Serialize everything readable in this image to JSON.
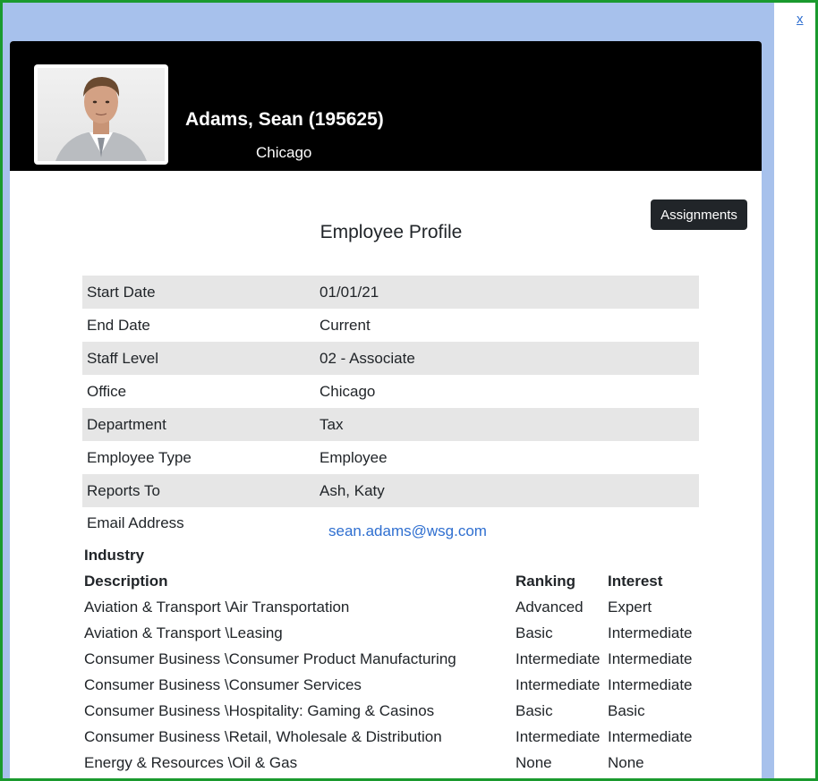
{
  "close_label": "x",
  "header": {
    "name": "Adams, Sean (195625)",
    "city": "Chicago"
  },
  "assignments_label": "Assignments",
  "profile_title": "Employee Profile",
  "details": [
    {
      "label": "Start Date",
      "value": "01/01/21"
    },
    {
      "label": "End Date",
      "value": "Current"
    },
    {
      "label": "Staff Level",
      "value": "02 - Associate"
    },
    {
      "label": "Office",
      "value": "Chicago"
    },
    {
      "label": "Department",
      "value": "Tax"
    },
    {
      "label": "Employee Type",
      "value": "Employee"
    },
    {
      "label": "Reports To",
      "value": "Ash, Katy"
    }
  ],
  "email": {
    "label": "Email Address",
    "value": "sean.adams@wsg.com"
  },
  "industry": {
    "title": "Industry",
    "columns": {
      "description": "Description",
      "ranking": "Ranking",
      "interest": "Interest"
    },
    "rows": [
      {
        "description": "Aviation & Transport \\Air Transportation",
        "ranking": "Advanced",
        "interest": "Expert"
      },
      {
        "description": "Aviation & Transport \\Leasing",
        "ranking": "Basic",
        "interest": "Intermediate"
      },
      {
        "description": "Consumer Business \\Consumer Product Manufacturing",
        "ranking": "Intermediate",
        "interest": "Intermediate"
      },
      {
        "description": "Consumer Business \\Consumer Services",
        "ranking": "Intermediate",
        "interest": "Intermediate"
      },
      {
        "description": "Consumer Business \\Hospitality: Gaming & Casinos",
        "ranking": "Basic",
        "interest": "Basic"
      },
      {
        "description": "Consumer Business \\Retail, Wholesale & Distribution",
        "ranking": "Intermediate",
        "interest": "Intermediate"
      },
      {
        "description": "Energy & Resources \\Oil & Gas",
        "ranking": "None",
        "interest": "None"
      }
    ]
  },
  "colors": {
    "frame_border": "#1a9a2e",
    "backdrop": "#a7c1ec",
    "header_bg": "#000000",
    "row_shade": "#e6e6e6",
    "link": "#2f6fd0",
    "button_bg": "#212529"
  }
}
